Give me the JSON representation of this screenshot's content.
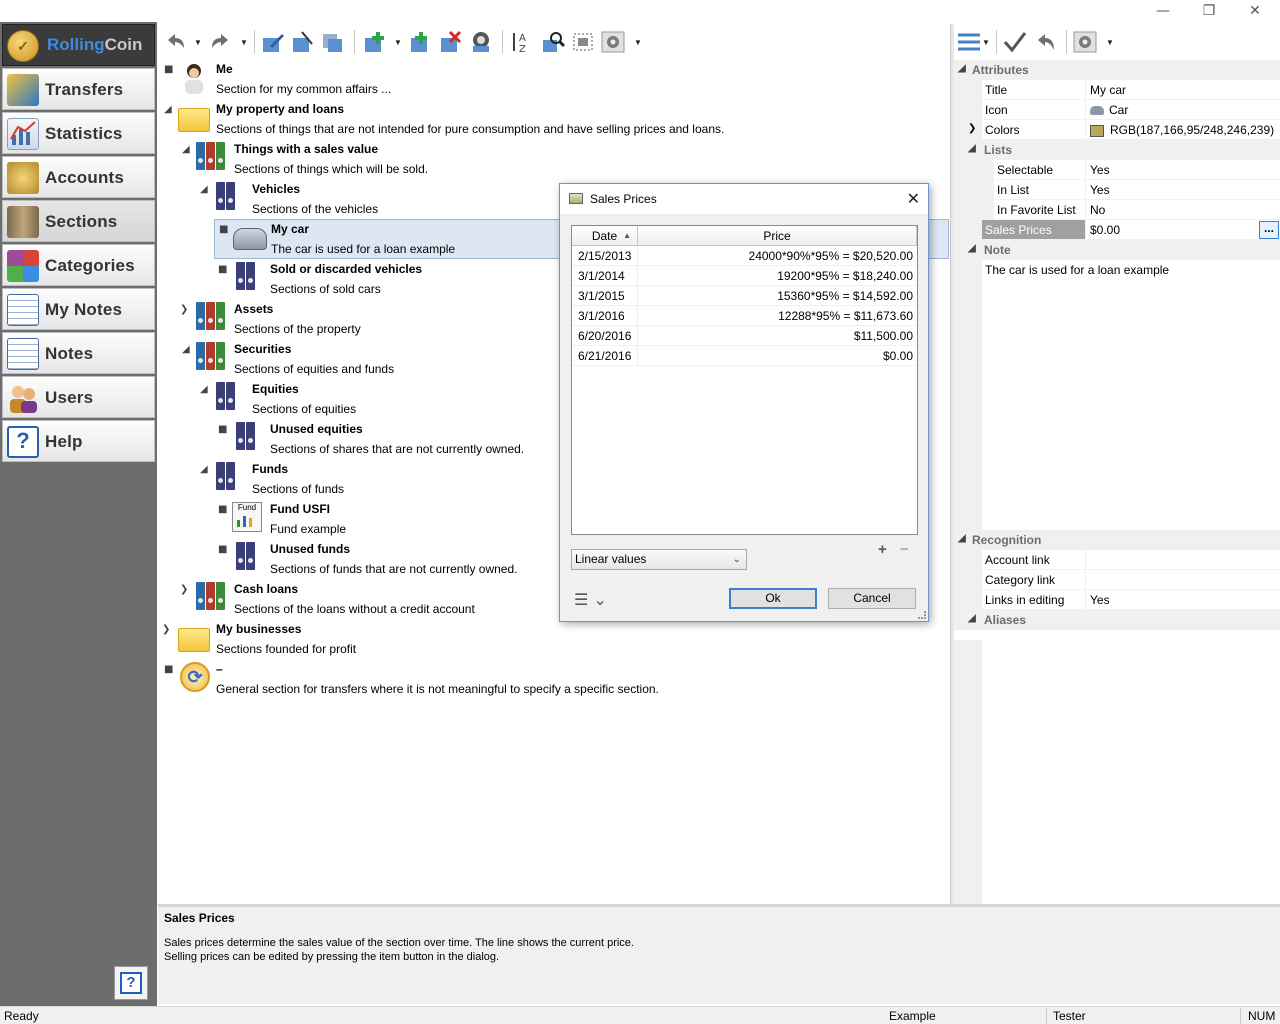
{
  "window": {
    "minimize": "—",
    "restore": "❐",
    "close": "✕"
  },
  "brand": {
    "part1": "Rolling",
    "part2": "Coin"
  },
  "nav": [
    {
      "label": "Transfers",
      "color": "#2f78c4"
    },
    {
      "label": "Statistics",
      "color": "#3f6fb0"
    },
    {
      "label": "Accounts",
      "color": "#b0892a"
    },
    {
      "label": "Sections",
      "color": "#7a6a4f"
    },
    {
      "label": "Categories",
      "color": "#a04a9a"
    },
    {
      "label": "My Notes",
      "color": "#4d6a9c"
    },
    {
      "label": "Notes",
      "color": "#4d6a9c"
    },
    {
      "label": "Users",
      "color": "#c48a2a"
    },
    {
      "label": "Help",
      "color": "#2a5fb0"
    }
  ],
  "tree": [
    {
      "title": "Me",
      "desc": "Section for my common affairs ..."
    },
    {
      "title": "My property and loans",
      "desc": "Sections of things that are not intended for pure consumption and have selling prices and loans."
    },
    {
      "title": "Things with a sales value",
      "desc": "Sections of things which will be sold."
    },
    {
      "title": "Vehicles",
      "desc": "Sections of the vehicles"
    },
    {
      "title": "My car",
      "desc": "The car is used for a loan example"
    },
    {
      "title": "Sold or discarded vehicles",
      "desc": "Sections of sold cars"
    },
    {
      "title": "Assets",
      "desc": "Sections of the property"
    },
    {
      "title": "Securities",
      "desc": "Sections of equities and funds"
    },
    {
      "title": "Equities",
      "desc": "Sections of equities"
    },
    {
      "title": "Unused equities",
      "desc": "Sections of shares that are not currently owned."
    },
    {
      "title": "Funds",
      "desc": "Sections of funds"
    },
    {
      "title": "Fund USFI",
      "desc": "Fund example"
    },
    {
      "title": "Unused funds",
      "desc": "Sections of funds that are not currently owned."
    },
    {
      "title": "Cash loans",
      "desc": "Sections of the loans without a credit account"
    },
    {
      "title": "My businesses",
      "desc": "Sections founded for profit"
    },
    {
      "title": "–",
      "desc": "General section for transfers where it is not meaningful to specify a specific section."
    }
  ],
  "fund_icon_text": "Fund",
  "props": {
    "attributes_label": "Attributes",
    "title_name": "Title",
    "title_value": "My car",
    "icon_name": "Icon",
    "icon_value": "Car",
    "colors_name": "Colors",
    "colors_value": "RGB(187,166,95/248,246,239)",
    "lists_label": "Lists",
    "selectable_name": "Selectable",
    "selectable_value": "Yes",
    "inlist_name": "In List",
    "inlist_value": "Yes",
    "fav_name": "In Favorite List",
    "fav_value": "No",
    "sales_name": "Sales Prices",
    "sales_value": "$0.00",
    "sales_btn": "...",
    "note_label": "Note",
    "note_text": "The car is used for a loan example",
    "recognition_label": "Recognition",
    "acclink_name": "Account link",
    "acclink_value": "",
    "catlink_name": "Category link",
    "catlink_value": "",
    "links_name": "Links in editing",
    "links_value": "Yes",
    "aliases_label": "Aliases",
    "swatch_color": "#bba65f"
  },
  "help": {
    "title": "Sales Prices",
    "line1": "Sales prices determine the sales value of the section over time. The line shows the current price.",
    "line2": "Selling prices can be edited by pressing the item button in the dialog."
  },
  "status": {
    "ready": "Ready",
    "db": "Example",
    "user": "Tester",
    "num": "NUM"
  },
  "dialog": {
    "title": "Sales Prices",
    "col_date": "Date",
    "col_price": "Price",
    "sort_arrow": "▲",
    "rows": [
      {
        "date": "2/15/2013",
        "price": "24000*90%*95% = $20,520.00"
      },
      {
        "date": "3/1/2014",
        "price": "19200*95% = $18,240.00"
      },
      {
        "date": "3/1/2015",
        "price": "15360*95% = $14,592.00"
      },
      {
        "date": "3/1/2016",
        "price": "12288*95% = $11,673.60"
      },
      {
        "date": "6/20/2016",
        "price": "$11,500.00"
      },
      {
        "date": "6/21/2016",
        "price": "$0.00"
      }
    ],
    "combo_value": "Linear values",
    "add": "+",
    "remove": "−",
    "ok": "Ok",
    "cancel": "Cancel",
    "menu": "☰ ⌄"
  }
}
